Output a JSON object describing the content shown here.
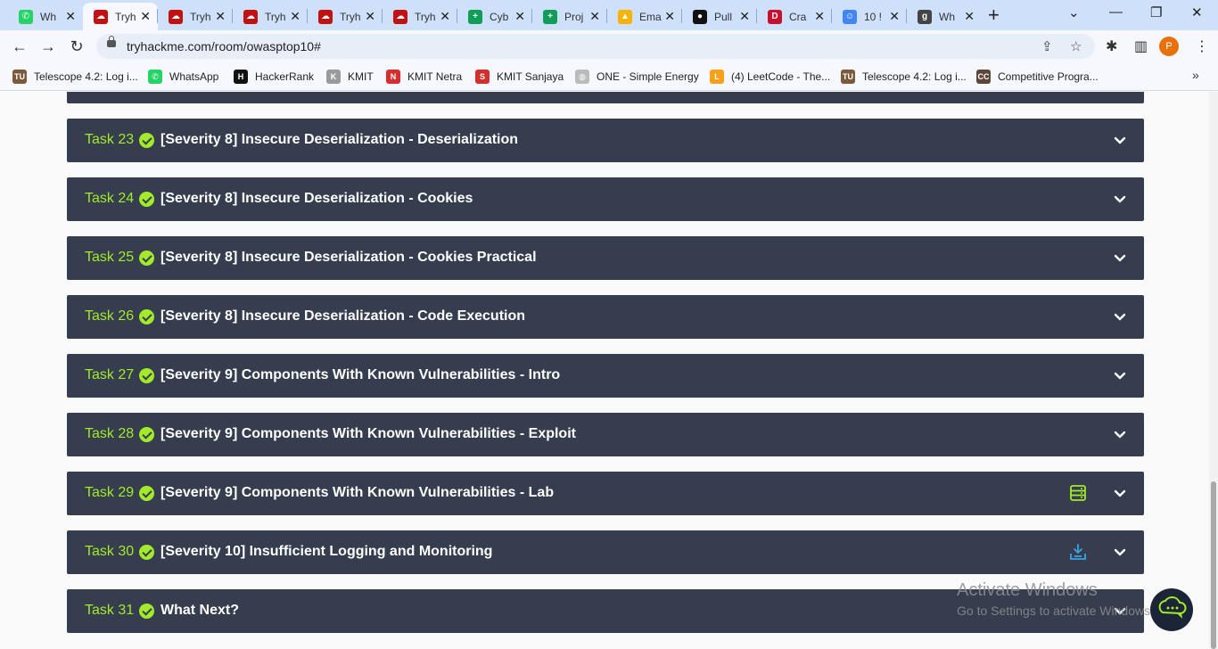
{
  "browser": {
    "tabs": [
      {
        "title": "Wh",
        "favicon": "whatsapp-icon",
        "color": "#25d366",
        "glyph": "✆",
        "active": false
      },
      {
        "title": "Tryh",
        "favicon": "tryhackme-icon",
        "color": "#c11111",
        "glyph": "☁",
        "active": true
      },
      {
        "title": "Tryh",
        "favicon": "tryhackme-icon",
        "color": "#c11111",
        "glyph": "☁",
        "active": false
      },
      {
        "title": "Tryh",
        "favicon": "tryhackme-icon",
        "color": "#c11111",
        "glyph": "☁",
        "active": false
      },
      {
        "title": "Tryh",
        "favicon": "tryhackme-icon",
        "color": "#c11111",
        "glyph": "☁",
        "active": false
      },
      {
        "title": "Tryh",
        "favicon": "tryhackme-icon",
        "color": "#c11111",
        "glyph": "☁",
        "active": false
      },
      {
        "title": "Cyb",
        "favicon": "google-sheets-icon",
        "color": "#0f9d58",
        "glyph": "+",
        "active": false
      },
      {
        "title": "Proj",
        "favicon": "google-sheets-icon",
        "color": "#0f9d58",
        "glyph": "+",
        "active": false
      },
      {
        "title": "Ema",
        "favicon": "google-drive-icon",
        "color": "#f4b400",
        "glyph": "▲",
        "active": false
      },
      {
        "title": "Pull",
        "favicon": "github-icon",
        "color": "#111111",
        "glyph": "●",
        "active": false
      },
      {
        "title": "Cra",
        "favicon": "d-app-icon",
        "color": "#c8102e",
        "glyph": "D",
        "active": false
      },
      {
        "title": "10 !",
        "favicon": "ghost-icon",
        "color": "#4285f4",
        "glyph": "☺",
        "active": false
      },
      {
        "title": "Wh",
        "favicon": "g-icon",
        "color": "#444444",
        "glyph": "g",
        "active": false
      }
    ],
    "close_glyph": "✕",
    "new_tab_glyph": "+",
    "window_controls": {
      "dropdown": "⌄",
      "minimize": "—",
      "restore": "❐",
      "close": "✕"
    },
    "nav": {
      "back": "←",
      "forward": "→",
      "reload": "↻"
    },
    "url": "tryhackme.com/room/owasptop10#",
    "omnibox_icons": {
      "share": "⇪",
      "star": "☆"
    },
    "toolbar_icons": {
      "extensions": "✱",
      "sidebar": "▥",
      "menu": "⋮"
    },
    "profile_initial": "P",
    "bookmarks": [
      {
        "label": "Telescope 4.2: Log i...",
        "favicon": "telescope-icon",
        "color": "#7a5a3a",
        "glyph": "TU"
      },
      {
        "label": "WhatsApp",
        "favicon": "whatsapp-icon",
        "color": "#25d366",
        "glyph": "✆"
      },
      {
        "label": "HackerRank",
        "favicon": "hackerrank-icon",
        "color": "#111111",
        "glyph": "H"
      },
      {
        "label": "KMIT",
        "favicon": "kmit-icon",
        "color": "#9a9a9a",
        "glyph": "K"
      },
      {
        "label": "KMIT Netra",
        "favicon": "kmit-netra-icon",
        "color": "#d32f2f",
        "glyph": "N"
      },
      {
        "label": "KMIT Sanjaya",
        "favicon": "kmit-sanjaya-icon",
        "color": "#d32f2f",
        "glyph": "S"
      },
      {
        "label": "ONE - Simple Energy",
        "favicon": "globe-icon",
        "color": "#bbbbbb",
        "glyph": "◍"
      },
      {
        "label": "(4) LeetCode - The...",
        "favicon": "leetcode-icon",
        "color": "#f89f1b",
        "glyph": "L"
      },
      {
        "label": "Telescope 4.2: Log i...",
        "favicon": "telescope-icon",
        "color": "#7a5a3a",
        "glyph": "TU"
      },
      {
        "label": "Competitive Progra...",
        "favicon": "codechef-icon",
        "color": "#5b4638",
        "glyph": "CC"
      }
    ],
    "bookmarks_more": "»"
  },
  "tasks": [
    {
      "num": "Task 23",
      "title": "[Severity 8] Insecure Deserialization - Deserialization",
      "extra": ""
    },
    {
      "num": "Task 24",
      "title": "[Severity 8] Insecure Deserialization - Cookies",
      "extra": ""
    },
    {
      "num": "Task 25",
      "title": "[Severity 8] Insecure Deserialization - Cookies Practical",
      "extra": ""
    },
    {
      "num": "Task 26",
      "title": "[Severity 8] Insecure Deserialization - Code Execution",
      "extra": ""
    },
    {
      "num": "Task 27",
      "title": "[Severity 9] Components With Known Vulnerabilities - Intro",
      "extra": ""
    },
    {
      "num": "Task 28",
      "title": "[Severity 9] Components With Known Vulnerabilities - Exploit",
      "extra": ""
    },
    {
      "num": "Task 29",
      "title": "[Severity 9] Components With Known Vulnerabilities - Lab",
      "extra": "server-icon"
    },
    {
      "num": "Task 30",
      "title": "[Severity 10] Insufficient Logging and Monitoring",
      "extra": "download-icon"
    },
    {
      "num": "Task 31",
      "title": "What Next?",
      "extra": ""
    }
  ],
  "colors": {
    "task_bg": "#353d4e",
    "accent_green": "#a3ea2a",
    "download_blue": "#3aa3e3"
  },
  "watermark": {
    "line1": "Activate Windows",
    "line2": "Go to Settings to activate Windows."
  }
}
